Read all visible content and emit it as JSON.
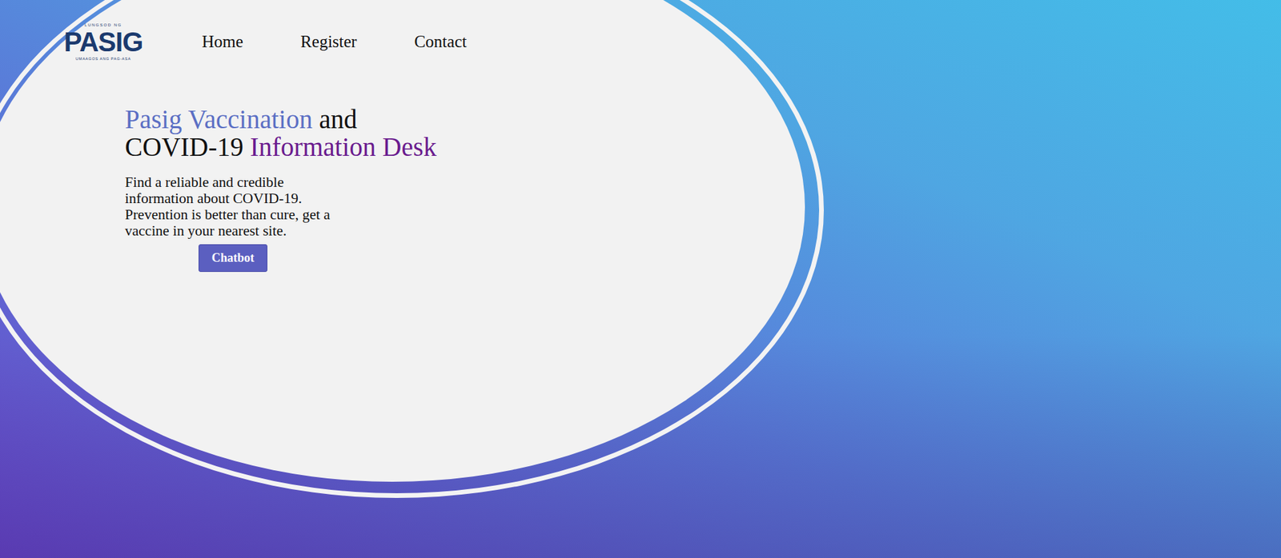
{
  "logo": {
    "top": "LUNGSOD NG",
    "name": "PASIG",
    "bottom": "UMAAGOS ANG PAG-ASA"
  },
  "nav": [
    {
      "label": "Home"
    },
    {
      "label": "Register"
    },
    {
      "label": "Contact"
    }
  ],
  "hero": {
    "title_lines": [
      [
        {
          "text": "Pasig Vaccination",
          "color": "#5b6fc4"
        },
        {
          "text": " and",
          "color": "#111111"
        }
      ],
      [
        {
          "text": "COVID-19 ",
          "color": "#111111"
        },
        {
          "text": "Information Desk",
          "color": "#6a1b8e"
        }
      ]
    ],
    "description": "Find a reliable and credible information about COVID-19. Prevention is better than cure, get a vaccine in your nearest site.",
    "button": "Chatbot"
  }
}
